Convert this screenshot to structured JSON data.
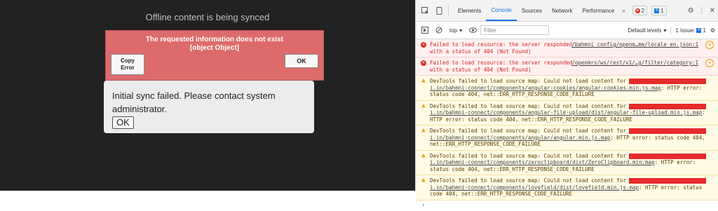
{
  "app": {
    "sync_title": "Offline content is being synced",
    "error_dialog": {
      "line1": "The requested information does not exist",
      "line2": "[object Object]",
      "copy_label_1": "Copy",
      "copy_label_2": "Error",
      "ok_label": "OK"
    },
    "sync_fail": {
      "line1": "Initial sync failed. Please contact system",
      "line2": "administrator.",
      "ok_label": "OK"
    }
  },
  "devtools": {
    "tabs": [
      "Elements",
      "Console",
      "Sources",
      "Network",
      "Performance"
    ],
    "active_tab": "Console",
    "errors_count": "2",
    "messages_count": "1",
    "toolbar": {
      "context": "top",
      "filter_placeholder": "Filter",
      "levels": "Default levels",
      "issue_label": "1 Issue:",
      "issue_count": "1"
    },
    "messages": [
      {
        "type": "error",
        "line1": "Failed to load resource: the server responded",
        "line2": "with a status of 404 (Not Found)",
        "source": "/bahmni_config/openm…me/locale_en.json:1"
      },
      {
        "type": "error",
        "line1": "Failed to load resource: the server responded",
        "line2": "with a status of 404 (Not Found)",
        "source": "/openmrs/ws/rest/v1/…g/filter/category:1"
      },
      {
        "type": "warn",
        "line1": "DevTools failed to load source map: Could not load content for",
        "line2": "i.in/bahmni-connect/components/angular-cookies/angular-cookies.min.js.map",
        "line2b": ": HTTP error:",
        "line3": "status code 404, net::ERR_HTTP_RESPONSE_CODE_FAILURE"
      },
      {
        "type": "warn",
        "line1": "DevTools failed to load source map: Could not load content for",
        "line2": "i.in/bahmni-connect/components/angular-file-upload/dist/angular-file-upload.min.js.map",
        "line2b": ":",
        "line3": "HTTP error: status code 404, net::ERR_HTTP_RESPONSE_CODE_FAILURE"
      },
      {
        "type": "warn",
        "line1": "DevTools failed to load source map: Could not load content for",
        "line2": "i.in/bahmni-connect/components/angular/angular.min.js.map",
        "line2b": ": HTTP error: status code 404,",
        "line3": "net::ERR_HTTP_RESPONSE_CODE_FAILURE"
      },
      {
        "type": "warn",
        "line1": "DevTools failed to load source map: Could not load content for",
        "line2": "i.in/bahmni-connect/components/zeroclipboard/dist/ZeroClipboard.min.map",
        "line2b": ": HTTP error:",
        "line3": "status code 404, net::ERR_HTTP_RESPONSE_CODE_FAILURE"
      },
      {
        "type": "warn",
        "line1": "DevTools failed to load source map: Could not load content for",
        "line2": "i.in/bahmni-connect/components/lovefield/dist/lovefield.min.js.map",
        "line2b": ": HTTP error: status",
        "line3": "code 404, net::ERR_HTTP_RESPONSE_CODE_FAILURE"
      }
    ]
  }
}
